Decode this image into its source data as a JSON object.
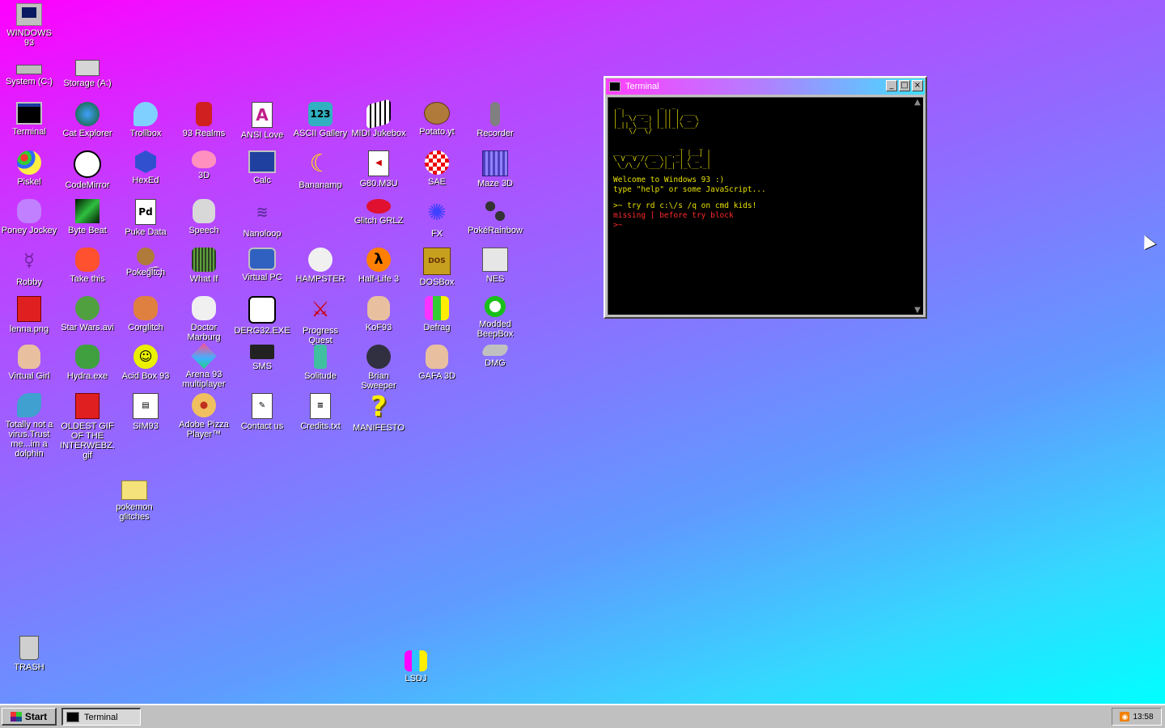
{
  "desktop": {
    "icons": {
      "windows93": "WINDOWS 93",
      "system": "System (C:)",
      "storage": "Storage (A:)",
      "terminal": "Terminal",
      "cat_explorer": "Cat Explorer",
      "trollbox": "Trollbox",
      "realms": "93 Realms",
      "ansi": "ANSI Love",
      "ascii": "ASCII Gallery",
      "midi": "MIDI Jukebox",
      "potato": "Potato.yt",
      "recorder": "Recorder",
      "piskel": "Piskel",
      "codemirror": "CodeMirror",
      "hexed": "HexEd",
      "threed": "3D",
      "calc": "Calc",
      "bananamp": "Bananamp",
      "g80": "G80.M3U",
      "sae": "SAE",
      "maze": "Maze 3D",
      "poney": "Poney Jockey",
      "bytebeat": "Byte Beat",
      "puke": "Puke Data",
      "speech": "Speech",
      "nanoloop": "Nanoloop",
      "glitch": "Glitch GRLZ",
      "fx": "FX",
      "pokerainbow": "PokéRainbow",
      "robby": "Robby",
      "takethis": "Take this",
      "pokegl": "Pokeg͂͂l͞t͡c̡h",
      "whatif": "What If",
      "virtualpc": "Virtual PC",
      "hampster": "HAMPSTER",
      "halflife": "Half-Life 3",
      "dosbox": "DOSBox",
      "nes": "NES",
      "lenna": "lenna.png",
      "starwars": "Star Wars.avi",
      "corglitch": "Corglitch",
      "doctor": "Doctor Marburg",
      "derg": "DERG32.EXE",
      "progress": "Progress Quest",
      "kof": "KoF93",
      "defrag": "Defrag",
      "beepbox": "Modded BeepBox",
      "virtualgirl": "Virtual Girl",
      "hydra": "Hydra.exe",
      "acidbox": "Acid Box 93",
      "arena": "Arena 93 multiplayer",
      "sms": "SMS",
      "solitude": "Solitude",
      "brian": "Brian Sweeper",
      "gafa": "GAFA 3D",
      "dmg": "DMG",
      "dolphin": "Totally not a virus.Trust me...im a dolphin",
      "oldestgif": "OLDEST GIF OF THE INTERWEBZ.gif",
      "sim93": "SIM93",
      "pizza": "Adobe Pizza Player™",
      "contact": "Contact us",
      "credits": "Credits.txt",
      "manifesto": "MANIFESTO",
      "pokemonglitches": "pokemon glitches",
      "trash": "TRASH",
      "lsdj": "LSDJ"
    }
  },
  "terminal": {
    "title": "Terminal",
    "ascii_hello": " _          _  _\n| |_  ___  | || | ___\n| ' \\/ -_) | || |/ _ \\\n|_||_\\___| |_||_|\\___/\n    \\/  \\/",
    "ascii_world": "                 _    _\n__ __ __ ___  _ _| |__| |\n\\ V  V // _ \\| '_| / _` |\n \\_/\\_/ \\___/|_| |_\\__,_|",
    "line1": "Welcome to Windows 93 :)",
    "line2": "type \"help\" or some JavaScript...",
    "cmd": ">~ try rd c:\\/s /q on cmd kids!",
    "error": "missing [ before try block",
    "prompt": ">~"
  },
  "taskbar": {
    "start": "Start",
    "task_terminal": "Terminal",
    "clock": "13:58",
    "rss_icon": "rss-icon"
  }
}
